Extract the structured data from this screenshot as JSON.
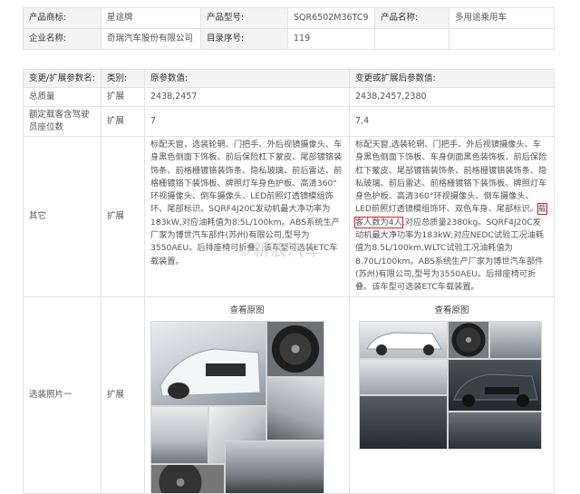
{
  "product_info": {
    "brand_label": "产品商标:",
    "brand_value": "星途牌",
    "model_label": "产品型号:",
    "model_value": "SQR6502M36TC9",
    "name_label": "产品名称:",
    "name_value": "多用途乘用车",
    "company_label": "企业名称:",
    "company_value": "奇瑞汽车股份有限公司",
    "catalog_label": "目录序号:",
    "catalog_value": "119"
  },
  "change_table": {
    "headers": {
      "param_name": "变更/扩展参数名:",
      "category": "类别:",
      "original": "原参数值:",
      "new": "变更或扩展后参数值:"
    },
    "rows": [
      {
        "name": "总质量",
        "category": "扩展",
        "original": "2438,2457",
        "new": "2438,2457,2380"
      },
      {
        "name": "额定载客含驾驶员座位数",
        "category": "扩展",
        "original": "7",
        "new": "7,4"
      }
    ],
    "other": {
      "name": "其它",
      "category": "扩展",
      "original_text": "标配天窗，选装轮辋、门把手、外后视镜摄像头、车身黑色侧面下饰板、前后保险杠下蒙皮、尾部镀铬装饰条、前格栅镀铬装饰条、隐私玻璃、前后雷达、前格栅镀铬下装饰板、牌照灯车身色护板、高清360°环视摄像头、倒车摄像头、LED前照灯透镜模组饰环、尾部标识。SQRF4J20C发动机最大净功率为183kW,对应油耗值为8.5L/100km。ABS系统生产厂家为博世汽车部件(苏州)有限公司,型号为3550AEU。后排座椅可折叠。该车型可选装ETC车载装置。",
      "new_text_before": "标配天窗,选装轮辋、门把手、外后视镜摄像头、车身黑色侧面下饰板、车身侧面黑色装饰板、前后保险杠下蒙皮、尾部镀铬装饰条、前格栅镀铬装饰条、隐私玻璃、前后雷达、前格栅镀铬下装饰板、牌照灯车身色护板、高清360°环视摄像头、倒车摄像头、LED前照灯透镜模组饰环、双色车身、尾部标识。",
      "new_text_highlight": "载客人数为4人",
      "new_text_after": ",对应总质量2380kg。SQRF4J20C发动机最大净功率为183kW,对应NEDC试验工况油耗值为8.5L/100km,WLTC试验工况油耗值为8.70L/100km。ABS系统生产厂家为博世汽车部件(苏州)有限公司,型号为3550AEU。后排座椅可折叠。该车型可选装ETC车载装置。"
    },
    "photo_row": {
      "name": "选装照片一",
      "category": "扩展",
      "original_title": "查看原图",
      "new_title": "查看原图"
    }
  },
  "watermark": "©新浪汽车",
  "colors": {
    "highlight_border": "#e0201c",
    "border": "#e3e3e3",
    "label_bg": "#f4f4f4"
  }
}
